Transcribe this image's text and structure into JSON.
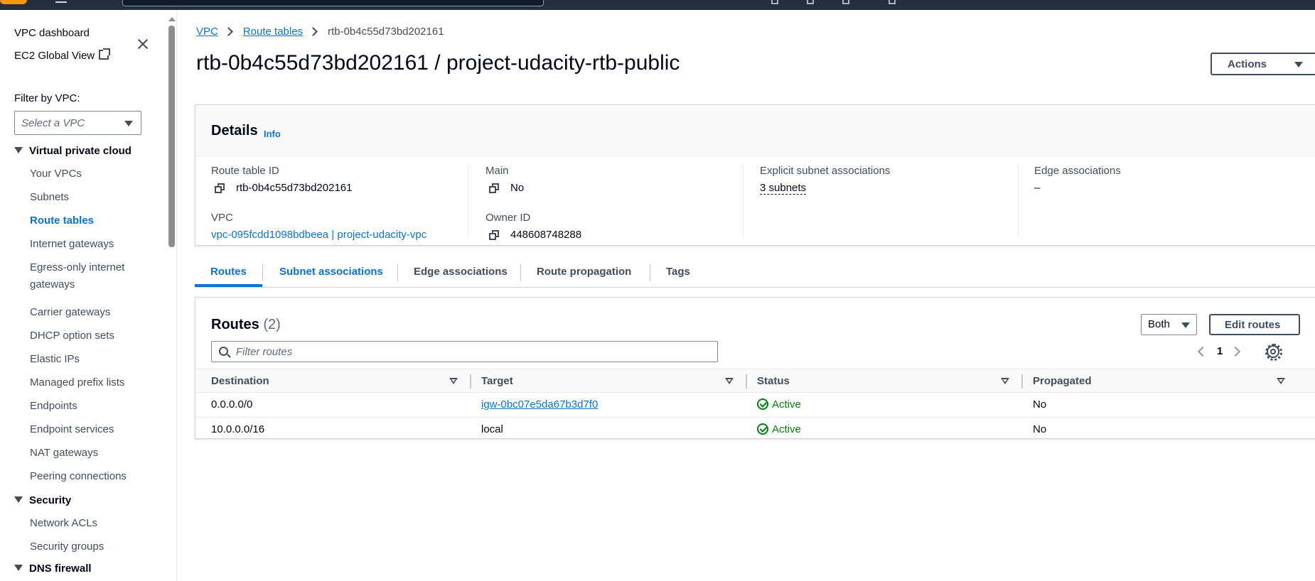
{
  "sidebar": {
    "dashboard_label": "VPC dashboard",
    "global_view_label": "EC2 Global View",
    "filter_label": "Filter by VPC:",
    "filter_placeholder": "Select a VPC",
    "sections": [
      {
        "title": "Virtual private cloud",
        "items": [
          "Your VPCs",
          "Subnets",
          "Route tables",
          "Internet gateways",
          "Egress-only internet gateways",
          "Carrier gateways",
          "DHCP option sets",
          "Elastic IPs",
          "Managed prefix lists",
          "Endpoints",
          "Endpoint services",
          "NAT gateways",
          "Peering connections"
        ]
      },
      {
        "title": "Security",
        "items": [
          "Network ACLs",
          "Security groups"
        ]
      },
      {
        "title": "DNS firewall",
        "items": []
      }
    ],
    "active_item": "Route tables"
  },
  "breadcrumb": {
    "items": [
      "VPC",
      "Route tables"
    ],
    "current": "rtb-0b4c55d73bd202161"
  },
  "page": {
    "title": "rtb-0b4c55d73bd202161 / project-udacity-rtb-public",
    "actions_label": "Actions"
  },
  "details": {
    "title": "Details",
    "info_label": "Info",
    "route_table_id_label": "Route table ID",
    "route_table_id": "rtb-0b4c55d73bd202161",
    "vpc_label": "VPC",
    "vpc_value": "vpc-095fcdd1098bdbeea | project-udacity-vpc",
    "main_label": "Main",
    "main_value": "No",
    "owner_id_label": "Owner ID",
    "owner_id": "448608748288",
    "explicit_label": "Explicit subnet associations",
    "explicit_value": "3 subnets",
    "edge_label": "Edge associations",
    "edge_value": "–"
  },
  "tabs": [
    "Routes",
    "Subnet associations",
    "Edge associations",
    "Route propagation",
    "Tags"
  ],
  "active_tab": "Routes",
  "routes": {
    "title": "Routes",
    "count": "(2)",
    "filter_select": "Both",
    "edit_label": "Edit routes",
    "filter_placeholder": "Filter routes",
    "page_number": "1",
    "columns": [
      "Destination",
      "Target",
      "Status",
      "Propagated"
    ],
    "rows": [
      {
        "destination": "0.0.0.0/0",
        "target": "igw-0bc07e5da67b3d7f0",
        "status": "Active",
        "propagated": "No"
      },
      {
        "destination": "10.0.0.0/16",
        "target": "local",
        "status": "Active",
        "propagated": "No"
      }
    ]
  },
  "colors": {
    "accent": "#0972d3",
    "success": "#037f0c",
    "nav_bg": "#232f3e"
  }
}
